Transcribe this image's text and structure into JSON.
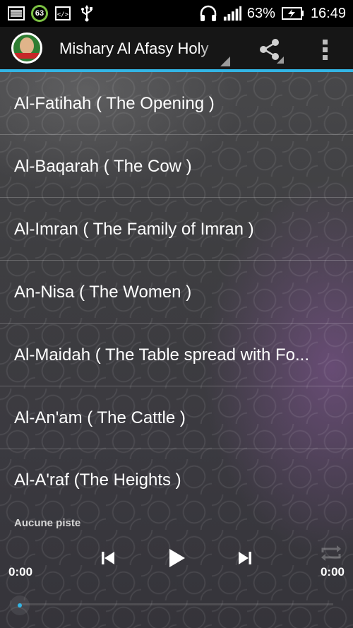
{
  "status_bar": {
    "notification_badge": "63",
    "battery_percent": "63%",
    "time": "16:49",
    "icons": [
      "image-icon",
      "battery-saver-badge-icon",
      "developer-code-icon",
      "usb-icon",
      "headset-icon",
      "signal-icon",
      "battery-charging-icon"
    ]
  },
  "action_bar": {
    "title": "Mishary Al Afasy Holy",
    "accent": "#33b5e5",
    "icons": [
      "app-logo-icon",
      "share-icon",
      "overflow-menu-icon"
    ]
  },
  "surahs": [
    {
      "label": "Al-Fatihah ( The Opening )"
    },
    {
      "label": "Al-Baqarah ( The Cow )"
    },
    {
      "label": "Al-Imran ( The Family of Imran )"
    },
    {
      "label": "An-Nisa ( The Women )"
    },
    {
      "label": "Al-Maidah ( The Table spread with Fo..."
    },
    {
      "label": "Al-An'am ( The Cattle )"
    },
    {
      "label": "Al-A'raf (The Heights )"
    }
  ],
  "player": {
    "track": "Aucune piste",
    "elapsed": "0:00",
    "duration": "0:00",
    "progress": 0,
    "icons": [
      "previous-icon",
      "play-icon",
      "next-icon",
      "repeat-icon"
    ]
  }
}
